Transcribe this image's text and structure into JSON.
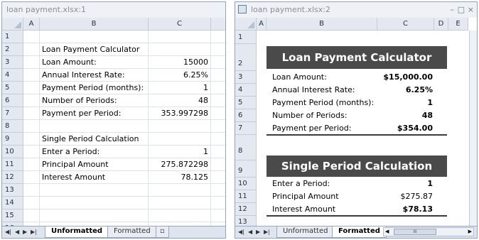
{
  "window1": {
    "title": "loan payment.xlsx:1",
    "columns": [
      "A",
      "B",
      "C"
    ],
    "rows": [
      "1",
      "2",
      "3",
      "4",
      "5",
      "6",
      "7",
      "8",
      "9",
      "10",
      "11",
      "12",
      "13",
      "14",
      "15",
      "16"
    ],
    "cells": [
      {
        "row": 2,
        "b": "Loan Payment Calculator",
        "c": ""
      },
      {
        "row": 3,
        "b": "Loan Amount:",
        "c": "15000"
      },
      {
        "row": 4,
        "b": "Annual Interest Rate:",
        "c": "6.25%"
      },
      {
        "row": 5,
        "b": "Payment Period (months):",
        "c": "1"
      },
      {
        "row": 6,
        "b": "Number of Periods:",
        "c": "48"
      },
      {
        "row": 7,
        "b": "Payment per Period:",
        "c": "353.997298"
      },
      {
        "row": 9,
        "b": "Single Period Calculation",
        "c": ""
      },
      {
        "row": 10,
        "b": "Enter a Period:",
        "c": "1"
      },
      {
        "row": 11,
        "b": "Principal Amount",
        "c": "275.872298"
      },
      {
        "row": 12,
        "b": "Interest Amount",
        "c": "78.125"
      }
    ],
    "tabs": [
      "Unformatted",
      "Formatted"
    ],
    "active_tab": "Unformatted"
  },
  "window2": {
    "title": "loan payment.xlsx:2",
    "columns": [
      "A",
      "B",
      "C",
      "D",
      "E"
    ],
    "banner1": "Loan Payment Calculator",
    "banner2": "Single Period Calculation",
    "rows_block1": [
      {
        "row": "3",
        "label": "Loan Amount:",
        "value": "$15,000.00"
      },
      {
        "row": "4",
        "label": "Annual Interest Rate:",
        "value": "6.25%"
      },
      {
        "row": "5",
        "label": "Payment Period (months):",
        "value": "1"
      },
      {
        "row": "6",
        "label": "Number of Periods:",
        "value": "48"
      },
      {
        "row": "7",
        "label": "Payment per Period:",
        "value": "$354.00"
      }
    ],
    "rows_block2": [
      {
        "row": "10",
        "label": "Enter a Period:",
        "value": "1"
      },
      {
        "row": "11",
        "label": "Principal Amount",
        "value": "$275.87"
      },
      {
        "row": "12",
        "label": "Interest Amount",
        "value": "$78.13"
      }
    ],
    "row_labels": {
      "r1": "1",
      "r2": "2",
      "r8": "8",
      "r9": "9",
      "r13": "13"
    },
    "tabs": [
      "Unformatted",
      "Formatted"
    ],
    "active_tab": "Formatted",
    "scroll_grip": "III"
  }
}
